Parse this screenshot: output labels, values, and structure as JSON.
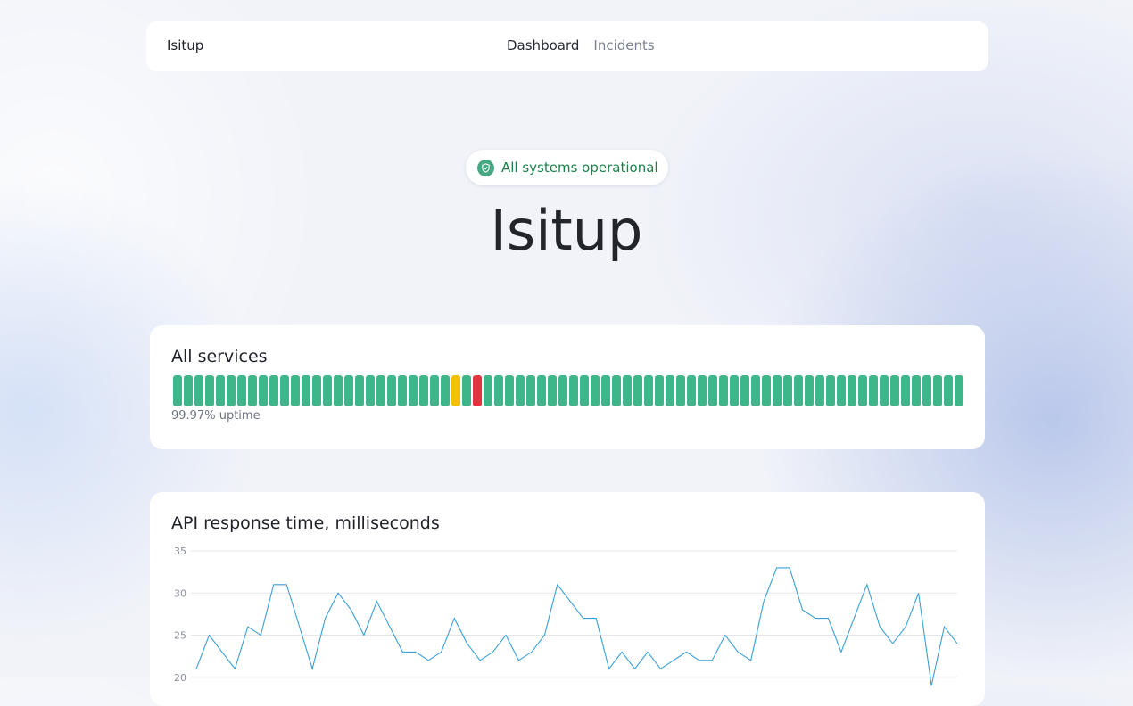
{
  "nav": {
    "brand": "Isitup",
    "links": [
      {
        "label": "Dashboard",
        "active": true
      },
      {
        "label": "Incidents",
        "active": false
      }
    ]
  },
  "status": {
    "text": "All systems operational",
    "icon": "shield-check-icon",
    "color": "#18824a"
  },
  "hero": {
    "title": "Isitup"
  },
  "services": {
    "title": "All services",
    "uptime": "99.97% uptime",
    "colors": {
      "up": "#3fb58a",
      "degraded": "#f5c000",
      "down": "#e0343f"
    },
    "days": [
      "up",
      "up",
      "up",
      "up",
      "up",
      "up",
      "up",
      "up",
      "up",
      "up",
      "up",
      "up",
      "up",
      "up",
      "up",
      "up",
      "up",
      "up",
      "up",
      "up",
      "up",
      "up",
      "up",
      "up",
      "up",
      "up",
      "degraded",
      "up",
      "down",
      "up",
      "up",
      "up",
      "up",
      "up",
      "up",
      "up",
      "up",
      "up",
      "up",
      "up",
      "up",
      "up",
      "up",
      "up",
      "up",
      "up",
      "up",
      "up",
      "up",
      "up",
      "up",
      "up",
      "up",
      "up",
      "up",
      "up",
      "up",
      "up",
      "up",
      "up",
      "up",
      "up",
      "up",
      "up",
      "up",
      "up",
      "up",
      "up",
      "up",
      "up",
      "up",
      "up",
      "up",
      "up"
    ]
  },
  "chart_data": {
    "type": "line",
    "title": "API response time, milliseconds",
    "ylim": [
      20,
      35
    ],
    "y_ticks": [
      35,
      30,
      25,
      20
    ],
    "grid": true,
    "line_color": "#3a9fd6",
    "values": [
      21,
      25,
      23,
      21,
      26,
      25,
      31,
      31,
      26,
      21,
      27,
      30,
      28,
      25,
      29,
      26,
      23,
      23,
      22,
      23,
      27,
      24,
      22,
      23,
      25,
      22,
      23,
      25,
      31,
      29,
      27,
      27,
      21,
      23,
      21,
      23,
      21,
      22,
      23,
      22,
      22,
      25,
      23,
      22,
      29,
      33,
      33,
      28,
      27,
      27,
      23,
      27,
      31,
      26,
      24,
      26,
      30,
      19,
      26,
      24
    ]
  }
}
